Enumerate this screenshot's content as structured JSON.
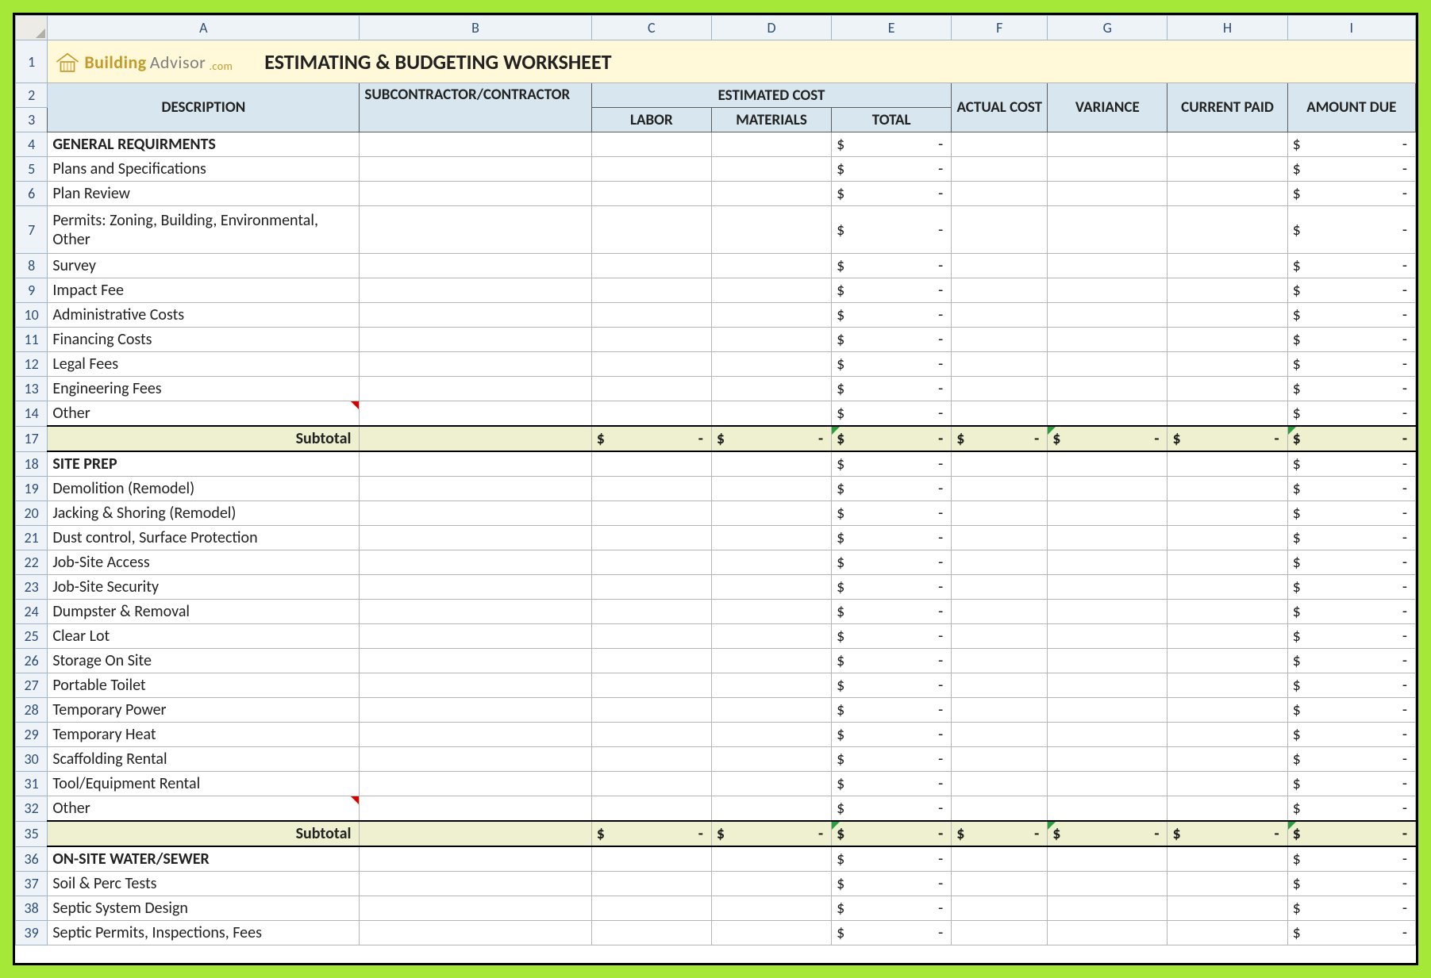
{
  "columns": [
    "A",
    "B",
    "C",
    "D",
    "E",
    "F",
    "G",
    "H",
    "I"
  ],
  "logo": {
    "t1": "Building",
    "t2": "Advisor",
    "t3": ".com"
  },
  "title": "ESTIMATING & BUDGETING WORKSHEET",
  "headers": {
    "description": "DESCRIPTION",
    "subcontractor": "SUBCONTRACTOR/CONTRACTOR",
    "estimated_cost": "ESTIMATED COST",
    "labor": "LABOR",
    "materials": "MATERIALS",
    "total": "TOTAL",
    "actual_cost": "ACTUAL COST",
    "variance": "VARIANCE",
    "current_paid": "CURRENT PAID",
    "amount_due": "AMOUNT DUE"
  },
  "currency_symbol": "$",
  "currency_empty": "-",
  "subtotal_label": "Subtotal",
  "rows": [
    {
      "n": 4,
      "type": "section",
      "desc": "GENERAL REQUIRMENTS"
    },
    {
      "n": 5,
      "type": "item",
      "desc": "Plans and Specifications"
    },
    {
      "n": 6,
      "type": "item",
      "desc": "Plan Review"
    },
    {
      "n": 7,
      "type": "item",
      "desc": "Permits: Zoning, Building, Environmental, Other",
      "wrap": true
    },
    {
      "n": 8,
      "type": "item",
      "desc": "Survey"
    },
    {
      "n": 9,
      "type": "item",
      "desc": "Impact Fee"
    },
    {
      "n": 10,
      "type": "item",
      "desc": "Administrative Costs"
    },
    {
      "n": 11,
      "type": "item",
      "desc": "Financing Costs"
    },
    {
      "n": 12,
      "type": "item",
      "desc": "Legal Fees"
    },
    {
      "n": 13,
      "type": "item",
      "desc": "Engineering Fees"
    },
    {
      "n": 14,
      "type": "item",
      "desc": "Other",
      "red": true
    },
    {
      "n": 17,
      "type": "subtotal"
    },
    {
      "n": 18,
      "type": "section",
      "desc": "SITE PREP"
    },
    {
      "n": 19,
      "type": "item",
      "desc": "Demolition (Remodel)"
    },
    {
      "n": 20,
      "type": "item",
      "desc": "Jacking & Shoring (Remodel)"
    },
    {
      "n": 21,
      "type": "item",
      "desc": "Dust control, Surface Protection"
    },
    {
      "n": 22,
      "type": "item",
      "desc": "Job-Site Access"
    },
    {
      "n": 23,
      "type": "item",
      "desc": "Job-Site Security"
    },
    {
      "n": 24,
      "type": "item",
      "desc": "Dumpster & Removal"
    },
    {
      "n": 25,
      "type": "item",
      "desc": "Clear Lot"
    },
    {
      "n": 26,
      "type": "item",
      "desc": "Storage On Site"
    },
    {
      "n": 27,
      "type": "item",
      "desc": "Portable Toilet"
    },
    {
      "n": 28,
      "type": "item",
      "desc": "Temporary Power"
    },
    {
      "n": 29,
      "type": "item",
      "desc": "Temporary Heat"
    },
    {
      "n": 30,
      "type": "item",
      "desc": "Scaffolding Rental"
    },
    {
      "n": 31,
      "type": "item",
      "desc": "Tool/Equipment Rental"
    },
    {
      "n": 32,
      "type": "item",
      "desc": "Other",
      "red": true
    },
    {
      "n": 35,
      "type": "subtotal"
    },
    {
      "n": 36,
      "type": "section",
      "desc": "ON-SITE WATER/SEWER"
    },
    {
      "n": 37,
      "type": "item",
      "desc": "Soil & Perc Tests"
    },
    {
      "n": 38,
      "type": "item",
      "desc": "Septic System Design"
    },
    {
      "n": 39,
      "type": "item",
      "desc": "Septic Permits, Inspections, Fees"
    }
  ]
}
